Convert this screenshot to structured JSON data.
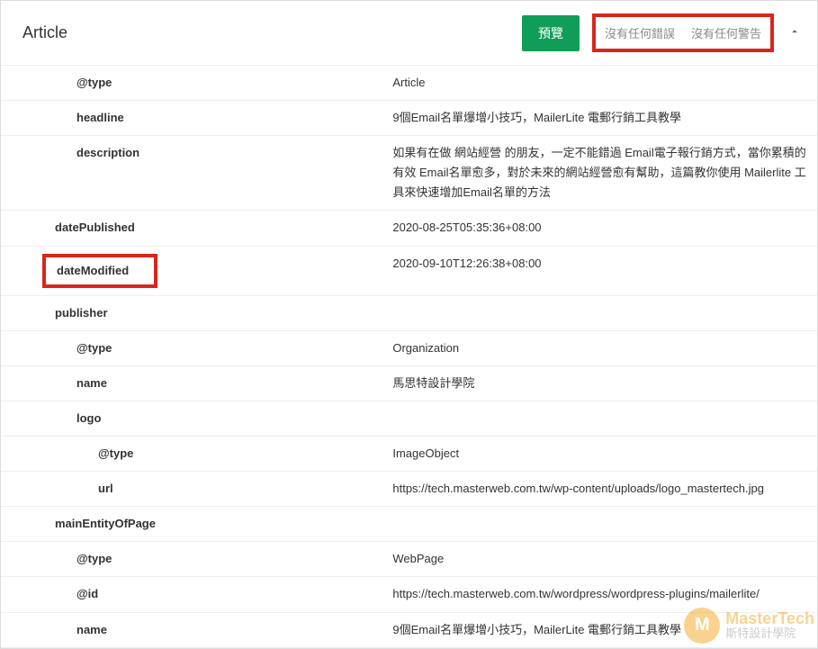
{
  "header": {
    "title": "Article",
    "preview_label": "預覽",
    "status_errors": "沒有任何錯誤",
    "status_warnings": "沒有任何警告"
  },
  "rows": [
    {
      "indent": 2,
      "key": "@type",
      "value": "Article",
      "highlight": false
    },
    {
      "indent": 2,
      "key": "headline",
      "value": "9個Email名單爆增小技巧，MailerLite 電郵行銷工具教學",
      "highlight": false
    },
    {
      "indent": 2,
      "key": "description",
      "value": "如果有在做 網站經營 的朋友，一定不能錯過 Email電子報行銷方式，當你累積的有效 Email名單愈多，對於未來的網站經營愈有幫助，這篇教你使用 Mailerlite 工具來快速增加Email名單的方法",
      "highlight": false
    },
    {
      "indent": 1,
      "key": "datePublished",
      "value": "2020-08-25T05:35:36+08:00",
      "highlight": false
    },
    {
      "indent": 1,
      "key": "dateModified",
      "value": "2020-09-10T12:26:38+08:00",
      "highlight": true
    },
    {
      "indent": 1,
      "key": "publisher",
      "value": "",
      "highlight": false
    },
    {
      "indent": 2,
      "key": "@type",
      "value": "Organization",
      "highlight": false
    },
    {
      "indent": 2,
      "key": "name",
      "value": "馬思特設計學院",
      "highlight": false
    },
    {
      "indent": 2,
      "key": "logo",
      "value": "",
      "highlight": false
    },
    {
      "indent": 3,
      "key": "@type",
      "value": "ImageObject",
      "highlight": false
    },
    {
      "indent": 3,
      "key": "url",
      "value": "https://tech.masterweb.com.tw/wp-content/uploads/logo_mastertech.jpg",
      "highlight": false
    },
    {
      "indent": 1,
      "key": "mainEntityOfPage",
      "value": "",
      "highlight": false
    },
    {
      "indent": 2,
      "key": "@type",
      "value": "WebPage",
      "highlight": false
    },
    {
      "indent": 2,
      "key": "@id",
      "value": "https://tech.masterweb.com.tw/wordpress/wordpress-plugins/mailerlite/",
      "highlight": false
    },
    {
      "indent": 2,
      "key": "name",
      "value": "9個Email名單爆增小技巧，MailerLite 電郵行銷工具教學",
      "highlight": false
    }
  ],
  "watermark": {
    "logo_letter": "M",
    "line1": "MasterTech",
    "line2": "斯特設計學院"
  }
}
